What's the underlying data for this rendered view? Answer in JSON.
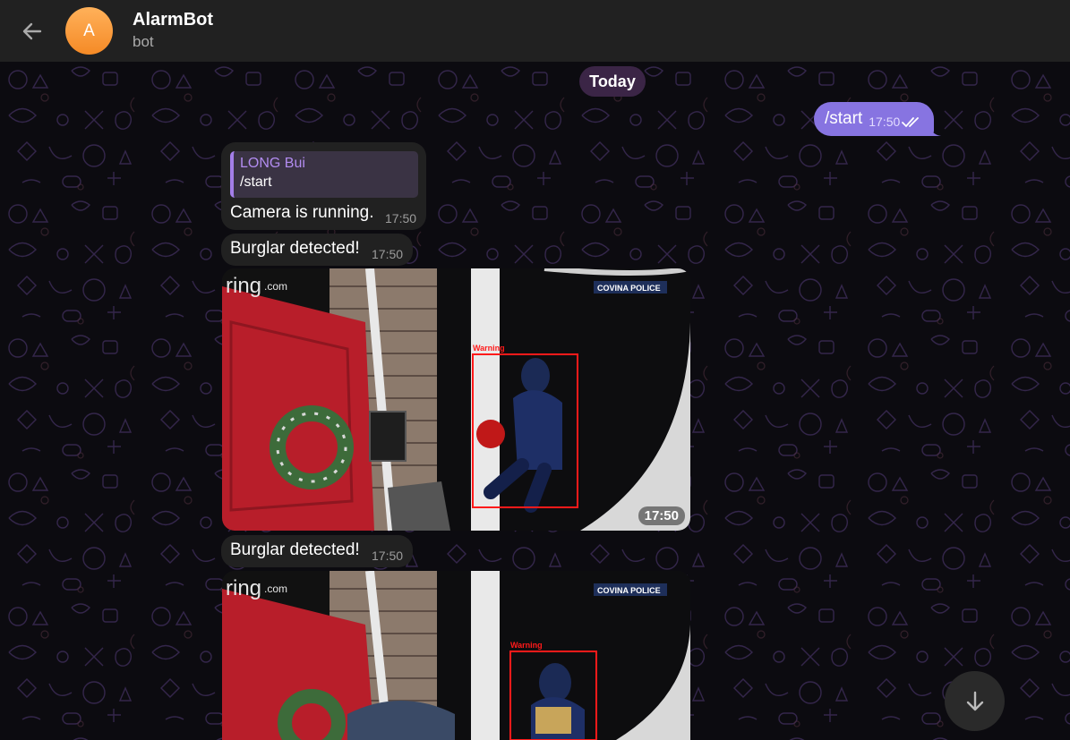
{
  "header": {
    "title": "AlarmBot",
    "status": "bot",
    "avatar_initial": "A",
    "avatar_color": "#f5932f"
  },
  "date_chip": "Today",
  "messages": {
    "outgoing": {
      "text": "/start",
      "time": "17:50"
    },
    "camera": {
      "reply_name": "LONG Bui",
      "reply_text": "/start",
      "text": "Camera is running.",
      "time": "17:50"
    },
    "burglar1": {
      "text": "Burglar detected!",
      "time": "17:50"
    },
    "photo1": {
      "time": "17:50",
      "logo": "ring",
      "logo_suffix": ".com",
      "watermark": "COVINA POLICE",
      "box_label": "Warning"
    },
    "burglar2": {
      "text": "Burglar detected!",
      "time": "17:50"
    },
    "photo2": {
      "logo": "ring",
      "logo_suffix": ".com",
      "watermark": "COVINA POLICE",
      "box_label": "Warning"
    }
  },
  "colors": {
    "outgoing_bubble": "#8774e1",
    "incoming_bubble": "#212121",
    "header": "#212121",
    "accent_reply": "#a37ee8"
  }
}
